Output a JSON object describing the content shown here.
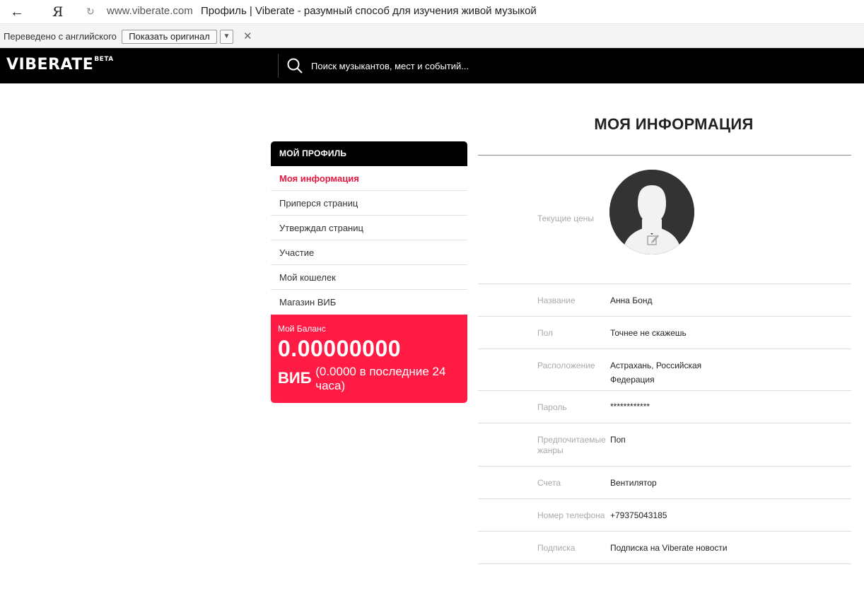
{
  "browser": {
    "yandex_glyph": "Я",
    "domain": "www.viberate.com",
    "page_title": "Профиль | Viberate - разумный способ для изучения живой музыкой"
  },
  "translation_bar": {
    "label": "Переведено с английского",
    "show_original": "Показать оригинал"
  },
  "header": {
    "logo": "VIBERATE",
    "logo_badge": "BETA",
    "search_placeholder": "Поиск музыкантов, мест и событий..."
  },
  "sidebar": {
    "title": "МОЙ ПРОФИЛЬ",
    "items": [
      {
        "label": "Моя информация",
        "active": true
      },
      {
        "label": "Приперся страниц",
        "active": false
      },
      {
        "label": "Утверждал страниц",
        "active": false
      },
      {
        "label": "Участие",
        "active": false
      },
      {
        "label": "Мой кошелек",
        "active": false
      },
      {
        "label": "Магазин ВИБ",
        "active": false
      }
    ],
    "balance": {
      "label": "Мой Баланс",
      "amount": "0.00000000",
      "currency": "ВИБ",
      "last24": "(0.0000 в последние 24 часа)"
    }
  },
  "main": {
    "title": "МОЯ ИНФОРМАЦИЯ",
    "avatar_label": "Текущие цены",
    "fields": [
      {
        "label": "Название",
        "value": "Анна Бонд"
      },
      {
        "label": "Пол",
        "value": "Точнее не скажешь"
      },
      {
        "label": "Расположение",
        "value": "Астрахань, Российская Федерация"
      },
      {
        "label": "Пароль",
        "value": "************"
      },
      {
        "label": "Предпочитаемые жанры",
        "value": "Поп"
      },
      {
        "label": "Счета",
        "value": "Вентилятор"
      },
      {
        "label": "Номер телефона",
        "value": "+79375043185"
      },
      {
        "label": "Подписка",
        "value": "Подписка на Viberate новости"
      }
    ]
  },
  "colors": {
    "accent": "#ff1b44",
    "header_bg": "#000000"
  }
}
